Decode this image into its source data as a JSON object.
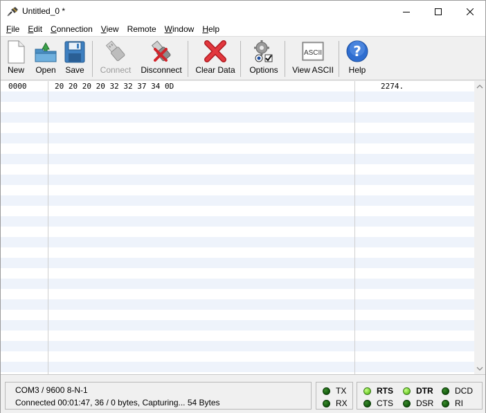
{
  "window": {
    "title": "Untitled_0 *"
  },
  "menu": [
    {
      "pre": "",
      "ul": "F",
      "post": "ile"
    },
    {
      "pre": "",
      "ul": "E",
      "post": "dit"
    },
    {
      "pre": "",
      "ul": "C",
      "post": "onnection"
    },
    {
      "pre": "",
      "ul": "V",
      "post": "iew"
    },
    {
      "pre": "Remote",
      "ul": "",
      "post": ""
    },
    {
      "pre": "",
      "ul": "W",
      "post": "indow"
    },
    {
      "pre": "",
      "ul": "H",
      "post": "elp"
    }
  ],
  "toolbar": {
    "new": "New",
    "open": "Open",
    "save": "Save",
    "connect": "Connect",
    "disconnect": "Disconnect",
    "clear": "Clear Data",
    "options": "Options",
    "view_ascii": "View ASCII",
    "ascii_icon_text": "ASCII",
    "help": "Help"
  },
  "data_rows": [
    {
      "offset": "0000",
      "hex": "20 20 20 20 32 32 37 34 0D",
      "ascii": "2274."
    }
  ],
  "status": {
    "port": "COM3 / 9600 8-N-1",
    "connection": "Connected 00:01:47, 36 / 0 bytes, Capturing... 54 Bytes"
  },
  "leds": {
    "tx": "TX",
    "rx": "RX",
    "rts": "RTS",
    "cts": "CTS",
    "dtr": "DTR",
    "dsr": "DSR",
    "dcd": "DCD",
    "ri": "RI"
  },
  "colors": {
    "row_alt": "#eef3fb",
    "led_on": "#7fd63a",
    "led_off": "#165e10",
    "close_x": "#d2232a"
  }
}
